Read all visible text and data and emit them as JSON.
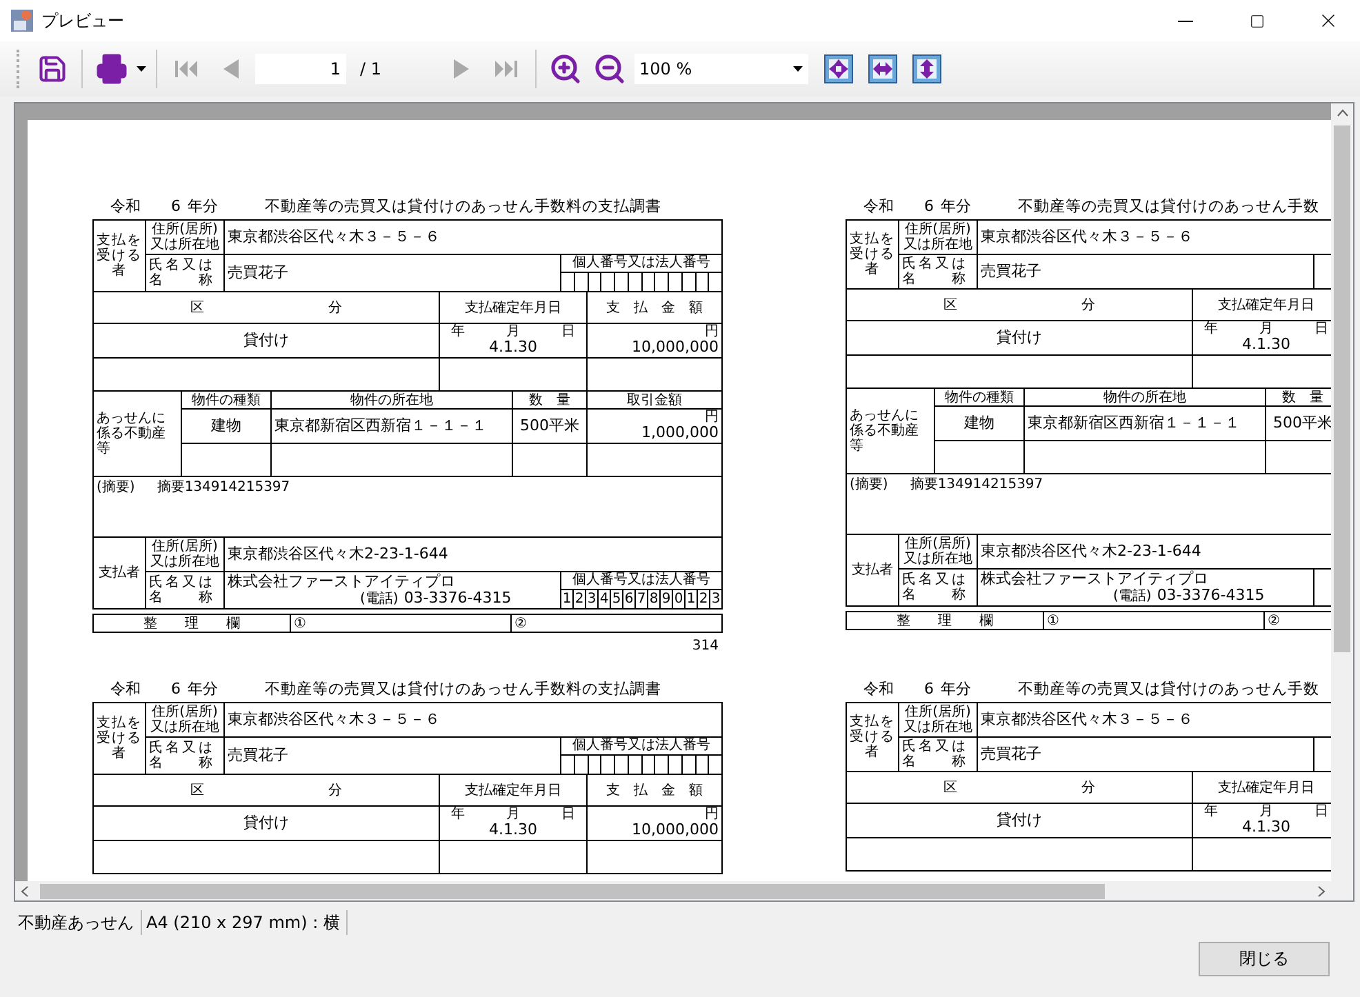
{
  "window": {
    "title": "プレビュー"
  },
  "toolbar": {
    "nav_buttons": [
      {
        "kind": "first",
        "disabled": true
      },
      {
        "kind": "prev",
        "disabled": true
      },
      {
        "kind": "next",
        "disabled": true
      },
      {
        "kind": "last",
        "disabled": true
      }
    ],
    "page_input": {
      "value": "1"
    },
    "page_total": "/ 1",
    "zoom": {
      "value": "100 %"
    }
  },
  "pages": [
    {
      "header_era": "令和",
      "header_year": "6",
      "header_suffix": "年分",
      "title": "不動産等の売買又は貸付けのあっせん手数料の支払調書",
      "payee": {
        "group_label": "支払を受ける者",
        "address_label": "住所(居所)\n又は所在地",
        "address": "東京都渋谷区代々木３－５－６",
        "name_label": "氏名又は名　　称",
        "name": "売買花子",
        "number_label": "個人番号又は法人番号"
      },
      "kubun_header": "区　　　　　　　　　分",
      "date_header": "支払確定年月日",
      "amount_header": "支　払　金　額",
      "kubun": "貸付け",
      "date_units": "年　　　月　　　日",
      "date": "4.1.30",
      "amount_unit": "円",
      "amount": "10,000,000",
      "property": {
        "group_label": "あっせんに係る不動産等",
        "type_header": "物件の種類",
        "location_header": "物件の所在地",
        "quantity_header": "数　量",
        "price_header": "取引金額",
        "type": "建物",
        "location": "東京都新宿区西新宿１－１－１",
        "quantity": "500平米",
        "price_unit": "円",
        "price": "1,000,000"
      },
      "memo_label": "(摘要)",
      "memo": "摘要134914215397",
      "payer": {
        "group_label": "支払者",
        "address_label": "住所(居所)\n又は所在地",
        "address": "東京都渋谷区代々木2-23-1-644",
        "name_label": "氏名又は名　　称",
        "name": "株式会社ファーストアイティプロ",
        "phone_label": "(電話)",
        "phone": "03-3376-4315",
        "number_label": "個人番号又は法人番号",
        "number_digits": [
          "1",
          "2",
          "3",
          "4",
          "5",
          "6",
          "7",
          "8",
          "9",
          "0",
          "1",
          "2",
          "3"
        ]
      },
      "remarks": {
        "label": "整　　理　　欄",
        "slot_1": "①",
        "slot_2": "②"
      },
      "page_number": "314"
    },
    {
      "header_era": "令和",
      "header_year": "6",
      "header_suffix": "年分",
      "title": "不動産等の売買又は貸付けのあっせん手数",
      "payee": {
        "group_label": "支払を受ける者",
        "address_label": "住所(居所)\n又は所在地",
        "address": "東京都渋谷区代々木３－５－６",
        "name_label": "氏名又は名　　称",
        "name": "売買花子"
      },
      "kubun_header": "区　　　　　　　　　分",
      "date_header": "支払確定年月日",
      "kubun": "貸付け",
      "date_units": "年　　　月　　　日",
      "date": "4.1.30",
      "property": {
        "group_label": "あっせんに係る不動産等",
        "type_header": "物件の種類",
        "location_header": "物件の所在地",
        "quantity_header": "数　量",
        "type": "建物",
        "location": "東京都新宿区西新宿１－１－１",
        "quantity": "500平米"
      },
      "memo_label": "(摘要)",
      "memo": "摘要134914215397",
      "payer": {
        "group_label": "支払者",
        "address_label": "住所(居所)\n又は所在地",
        "address": "東京都渋谷区代々木2-23-1-644",
        "name_label": "氏名又は名　　称",
        "name": "株式会社ファーストアイティプロ",
        "phone_label": "(電話)",
        "phone": "03-3376-4315"
      },
      "remarks": {
        "label": "整　　理　　欄",
        "slot_1": "①",
        "slot_2": "②"
      }
    },
    {
      "header_era": "令和",
      "header_year": "6",
      "header_suffix": "年分",
      "title": "不動産等の売買又は貸付けのあっせん手数料の支払調書",
      "payee": {
        "group_label": "支払を受ける者",
        "address_label": "住所(居所)\n又は所在地",
        "address": "東京都渋谷区代々木３－５－６",
        "name_label": "氏名又は名　　称",
        "name": "売買花子",
        "number_label": "個人番号又は法人番号"
      },
      "kubun_header": "区　　　　　　　　　分",
      "date_header": "支払確定年月日",
      "amount_header": "支　払　金　額",
      "kubun": "貸付け",
      "date_units": "年　　　月　　　日",
      "date": "4.1.30",
      "amount_unit": "円",
      "amount": "10,000,000"
    },
    {
      "header_era": "令和",
      "header_year": "6",
      "header_suffix": "年分",
      "title": "不動産等の売買又は貸付けのあっせん手数",
      "payee": {
        "group_label": "支払を受ける者",
        "address_label": "住所(居所)\n又は所在地",
        "address": "東京都渋谷区代々木３－５－６",
        "name_label": "氏名又は名　　称",
        "name": "売買花子"
      },
      "kubun_header": "区　　　　　　　　　分",
      "date_header": "支払確定年月日",
      "kubun": "貸付け",
      "date_units": "年　　　月　　　日",
      "date": "4.1.30"
    }
  ],
  "status_bar": [
    "不動産あっせん",
    "A4 (210 x 297 mm) : 横"
  ],
  "close_button": "閉じる"
}
